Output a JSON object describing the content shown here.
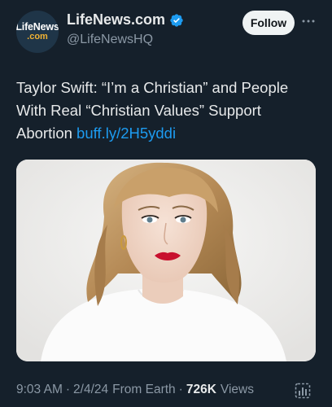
{
  "account": {
    "avatar_line1": "LifeNews",
    "avatar_line2": ".com",
    "display_name": "LifeNews.com",
    "handle": "@LifeNewsHQ",
    "verified": true
  },
  "actions": {
    "follow_label": "Follow",
    "more_icon": "more-horizontal-icon"
  },
  "tweet": {
    "text": "Taylor Swift: “I’m a Christian” and People With Real “Christian Values” Support Abortion",
    "link": "buff.ly/2H5yddi"
  },
  "meta": {
    "time": "9:03 AM",
    "date": "2/4/24",
    "source": "From Earth",
    "separator": "·",
    "views_count": "726K",
    "views_label": "Views"
  },
  "colors": {
    "background": "#15202b",
    "text": "#e7e9ea",
    "secondary": "#8b98a5",
    "link": "#1d9bf0",
    "verified_badge": "#1d9bf0"
  }
}
